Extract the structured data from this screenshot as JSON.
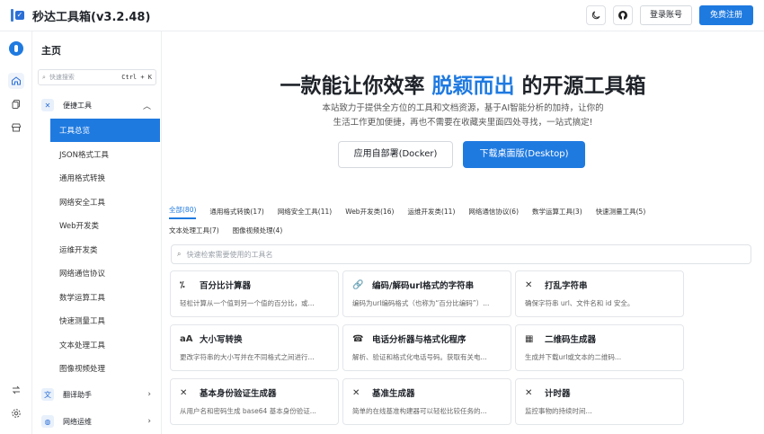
{
  "app": {
    "title": "秒达工具箱(v3.2.48)"
  },
  "topbar": {
    "login_label": "登录账号",
    "register_label": "免费注册",
    "theme_icon": "moon-icon",
    "github_icon": "github-icon"
  },
  "sidebar": {
    "home_label": "主页",
    "search_placeholder": "快速搜索",
    "search_shortcut": "Ctrl + K",
    "category_convenience": "便捷工具",
    "items": [
      "工具总览",
      "JSON格式工具",
      "通用格式转换",
      "网络安全工具",
      "Web开发类",
      "运维开发类",
      "网络通信协议",
      "数学运算工具",
      "快速测量工具",
      "文本处理工具",
      "图像视频处理"
    ],
    "category_translate": "翻译助手",
    "category_network": "网络运维"
  },
  "hero": {
    "title_prefix": "一款能让你效率",
    "title_highlight": "脱颖而出",
    "title_suffix": "的开源工具箱",
    "desc_line1": "本站致力于提供全方位的工具和文档资源，基于AI智能分析的加持，让你的",
    "desc_line2": "生活工作更加便捷，再也不需要在收藏夹里面四处寻找，一站式搞定!",
    "docker_button": "应用自部署(Docker)",
    "desktop_button": "下载桌面版(Desktop)"
  },
  "tabs": {
    "row1": [
      "全部(80)",
      "通用格式转换(17)",
      "网络安全工具(11)",
      "Web开发类(16)",
      "运维开发类(11)",
      "网络通信协议(6)",
      "数学运算工具(3)",
      "快速测量工具(5)"
    ],
    "row2": [
      "文本处理工具(7)",
      "图像视频处理(4)"
    ]
  },
  "tool_search": {
    "placeholder": "快速检索需要使用的工具名"
  },
  "cards": [
    {
      "icon": "percent-icon",
      "glyph": "⁒",
      "title": "百分比计算器",
      "desc": "轻松计算从一个值到另一个值的百分比，或..."
    },
    {
      "icon": "link-icon",
      "glyph": "🔗",
      "title": "编码/解码url格式的字符串",
      "desc": "编码为url编码格式（也称为“百分比编码”）..."
    },
    {
      "icon": "shuffle-icon",
      "glyph": "✕",
      "title": "打乱字符串",
      "desc": "确保字符串 url、文件名和 id 安全。"
    },
    {
      "icon": "case-icon",
      "glyph": "aA",
      "title": "大小写转换",
      "desc": "更改字符串的大小写并在不同格式之间进行..."
    },
    {
      "icon": "phone-icon",
      "glyph": "☎",
      "title": "电话分析器与格式化程序",
      "desc": "解析、验证和格式化电话号码。获取有关电..."
    },
    {
      "icon": "qrcode-icon",
      "glyph": "▦",
      "title": "二维码生成器",
      "desc": "生成并下载url或文本的二维码..."
    },
    {
      "icon": "tools-icon",
      "glyph": "✕",
      "title": "基本身份验证生成器",
      "desc": "从用户名和密码生成 base64 基本身份验证..."
    },
    {
      "icon": "tools-icon",
      "glyph": "✕",
      "title": "基准生成器",
      "desc": "简单的在线基准构建器可以轻松比较任务的..."
    },
    {
      "icon": "tools-icon",
      "glyph": "✕",
      "title": "计时器",
      "desc": "监控事物的持续时间..."
    }
  ]
}
